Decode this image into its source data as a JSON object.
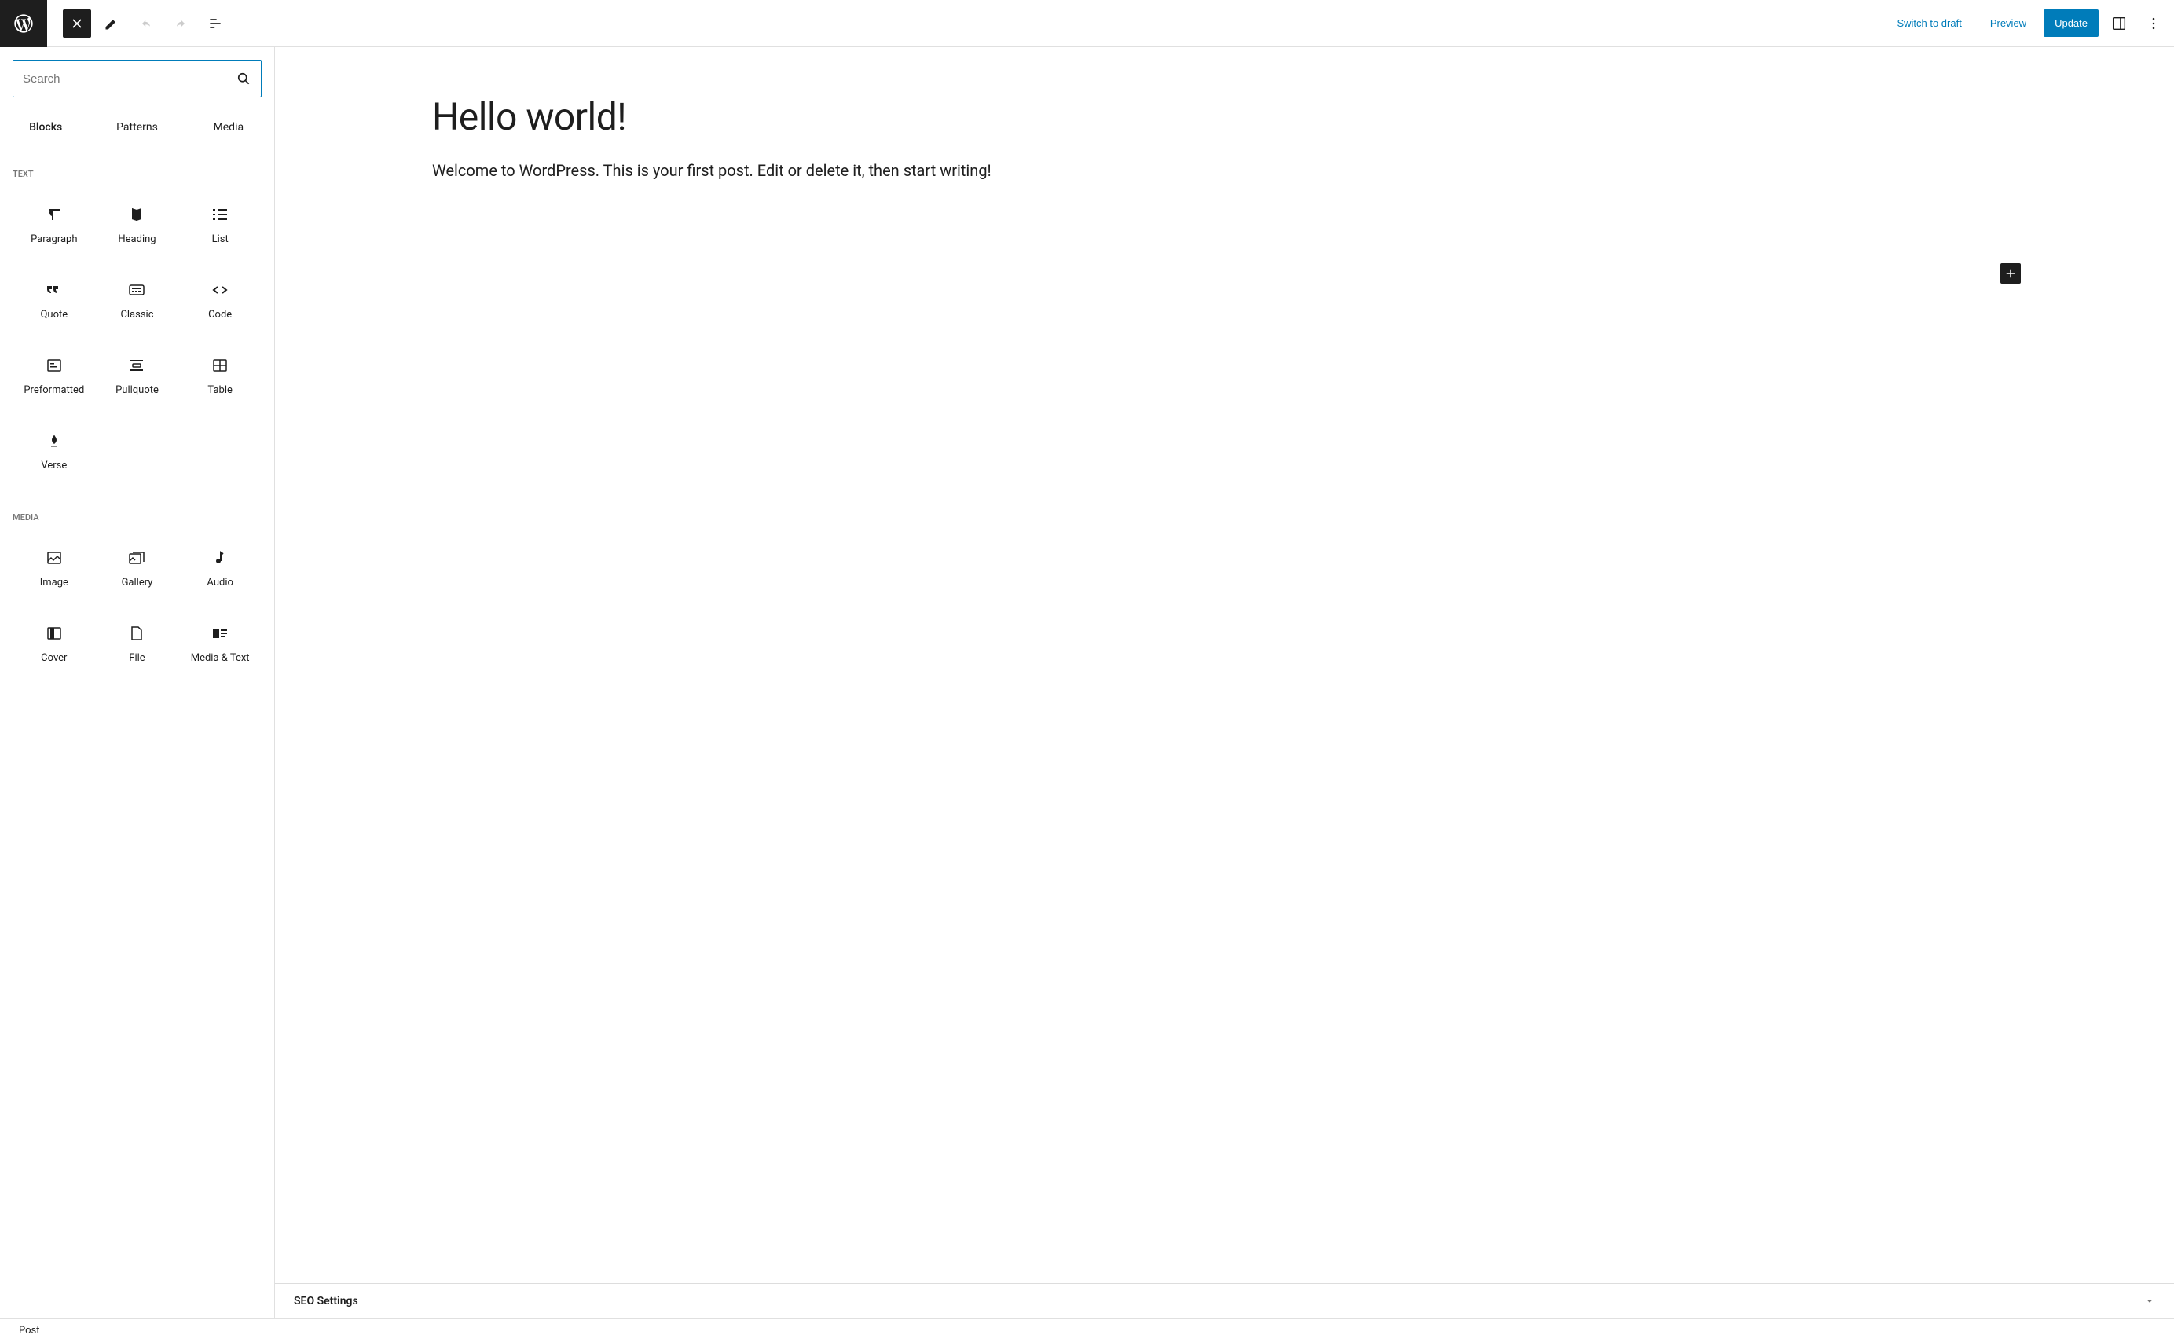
{
  "topbar": {
    "switch_to_draft": "Switch to draft",
    "preview": "Preview",
    "update": "Update"
  },
  "inserter": {
    "search_placeholder": "Search",
    "tabs": {
      "blocks": "Blocks",
      "patterns": "Patterns",
      "media": "Media"
    },
    "sections": {
      "text": {
        "label": "TEXT",
        "items": [
          {
            "label": "Paragraph",
            "icon": "paragraph"
          },
          {
            "label": "Heading",
            "icon": "heading"
          },
          {
            "label": "List",
            "icon": "list"
          },
          {
            "label": "Quote",
            "icon": "quote"
          },
          {
            "label": "Classic",
            "icon": "classic"
          },
          {
            "label": "Code",
            "icon": "code"
          },
          {
            "label": "Preformatted",
            "icon": "preformatted"
          },
          {
            "label": "Pullquote",
            "icon": "pullquote"
          },
          {
            "label": "Table",
            "icon": "table"
          },
          {
            "label": "Verse",
            "icon": "verse"
          }
        ]
      },
      "media": {
        "label": "MEDIA",
        "items": [
          {
            "label": "Image",
            "icon": "image"
          },
          {
            "label": "Gallery",
            "icon": "gallery"
          },
          {
            "label": "Audio",
            "icon": "audio"
          },
          {
            "label": "Cover",
            "icon": "cover"
          },
          {
            "label": "File",
            "icon": "file"
          },
          {
            "label": "Media & Text",
            "icon": "media-text"
          }
        ]
      }
    }
  },
  "editor": {
    "title": "Hello world!",
    "body": "Welcome to WordPress. This is your first post. Edit or delete it, then start writing!"
  },
  "seo_panel_label": "SEO Settings",
  "status": "Post"
}
